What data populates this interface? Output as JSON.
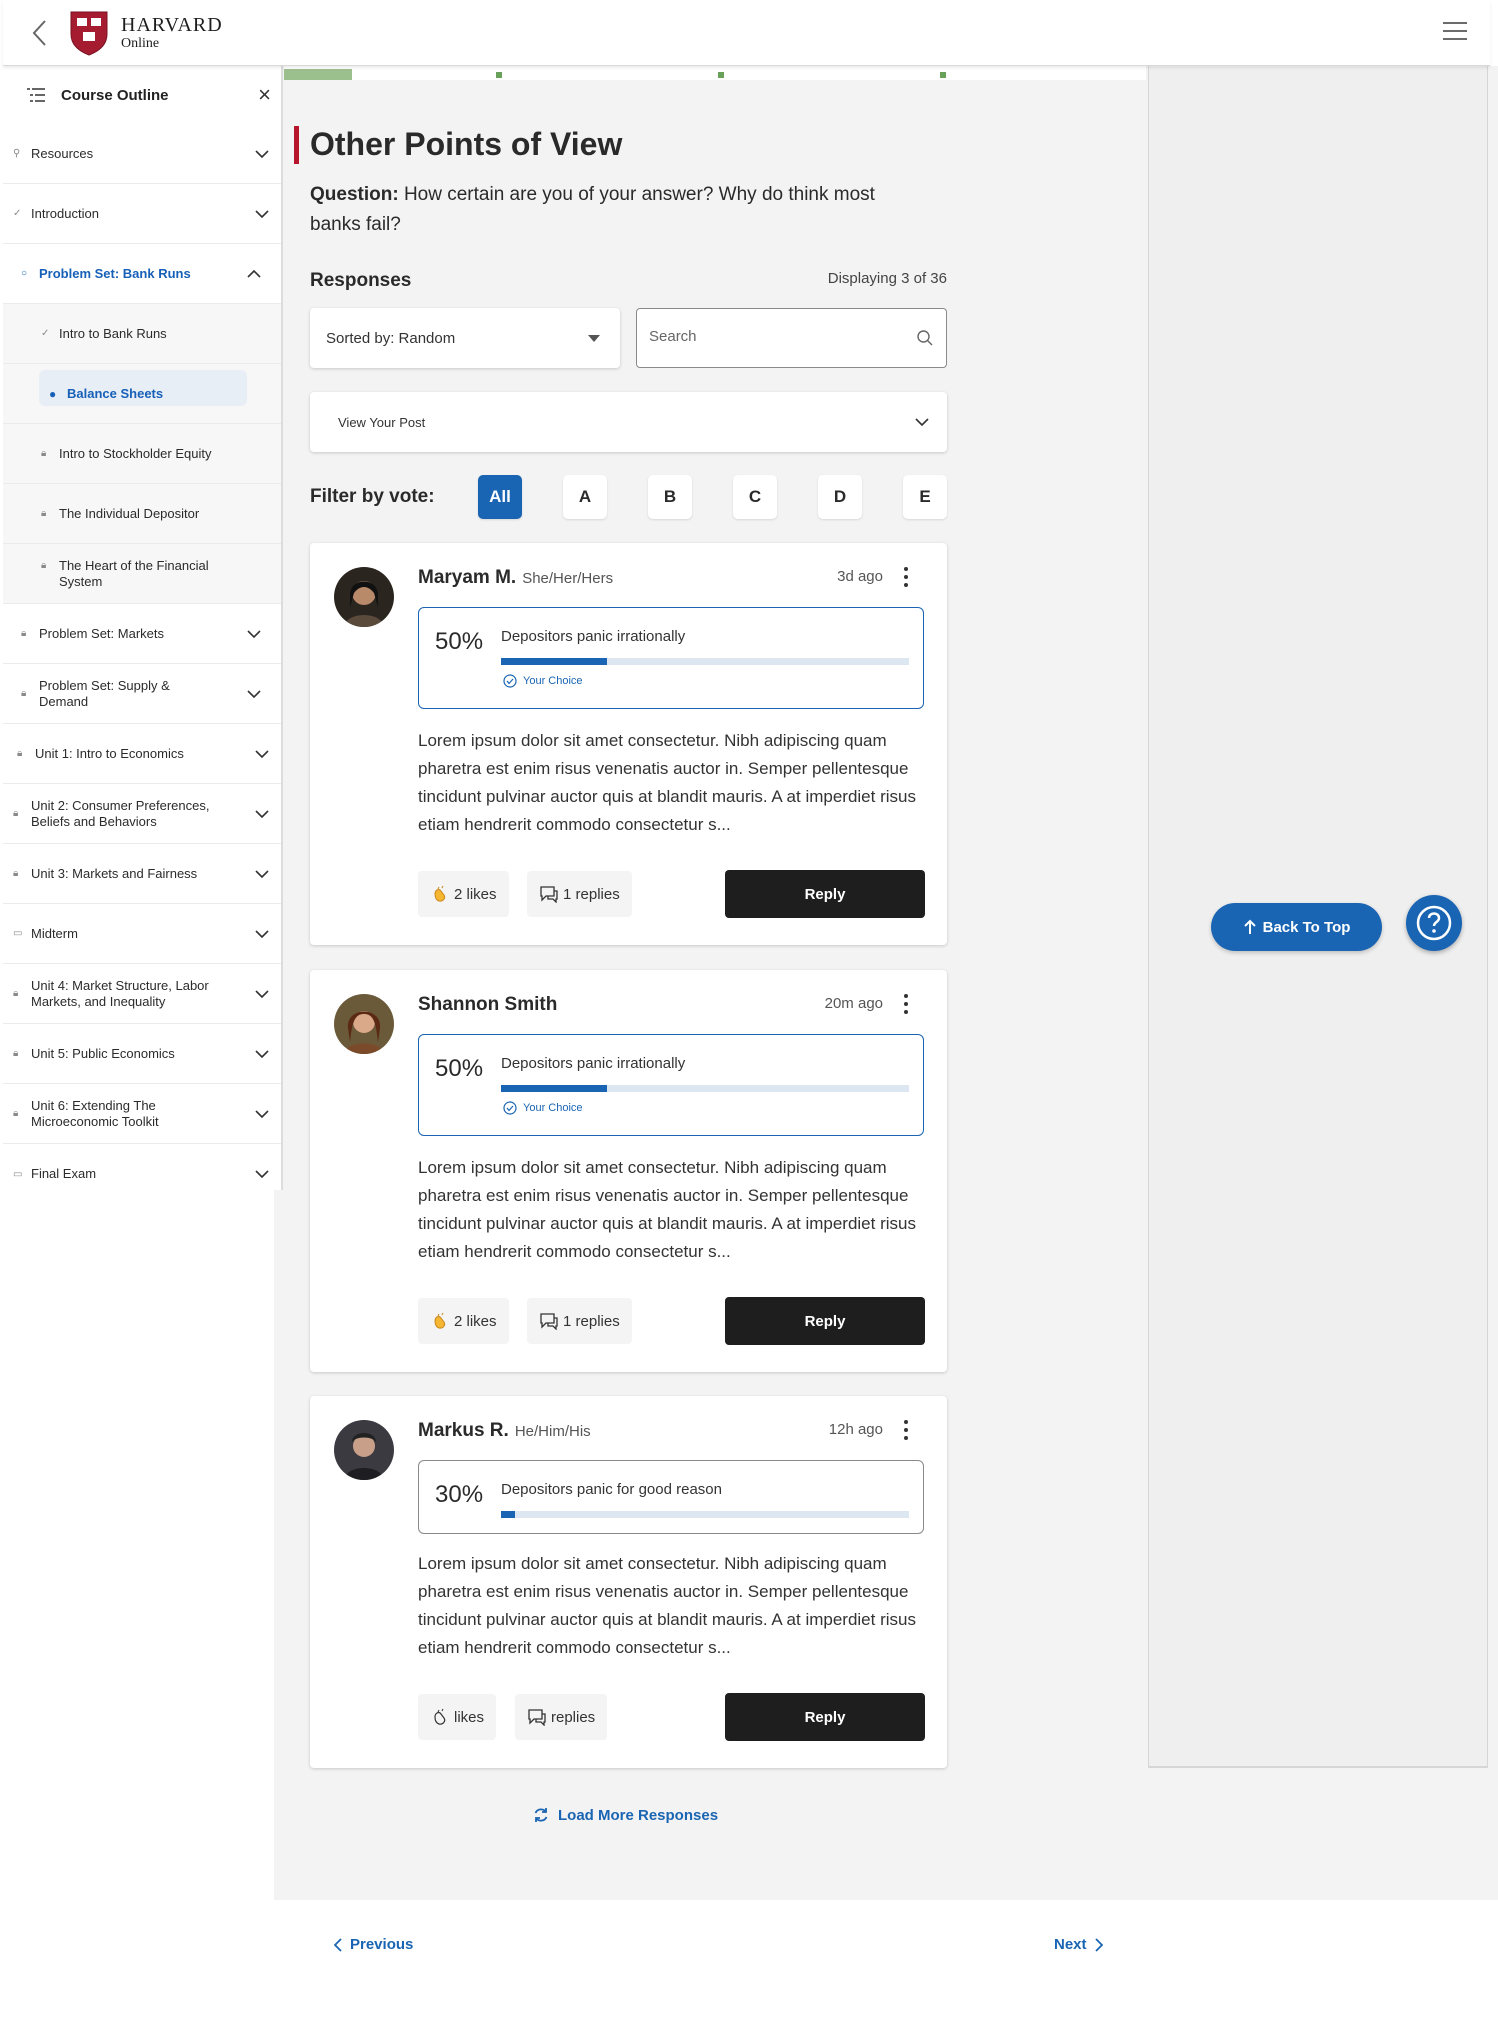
{
  "header": {
    "brand_title": "HARVARD",
    "brand_sub": "Online"
  },
  "sidebar": {
    "title": "Course Outline",
    "close": "×",
    "items": [
      {
        "label": "Resources"
      },
      {
        "label": "Introduction"
      },
      {
        "label": "Problem Set: Bank Runs"
      },
      {
        "label": "Intro to Bank Runs"
      },
      {
        "label": "Balance Sheets"
      },
      {
        "label": "Intro to Stockholder Equity"
      },
      {
        "label": "The Individual Depositor"
      },
      {
        "label": "The Heart of the Financial System"
      },
      {
        "label": "Problem Set: Markets"
      },
      {
        "label": "Problem Set: Supply & Demand"
      },
      {
        "label": "Unit 1: Intro to Economics"
      },
      {
        "label": "Unit 2: Consumer Preferences, Beliefs and Behaviors"
      },
      {
        "label": "Unit 3: Markets and Fairness"
      },
      {
        "label": "Midterm"
      },
      {
        "label": "Unit 4: Market Structure, Labor Markets, and Inequality"
      },
      {
        "label": "Unit 5: Public Economics"
      },
      {
        "label": "Unit 6: Extending The Microeconomic Toolkit"
      },
      {
        "label": "Final Exam"
      }
    ]
  },
  "main": {
    "heading": "Other Points of View",
    "question_label": "Question:",
    "question_text": "How certain are you of your answer? Why do think most banks fail?",
    "responses_title": "Responses",
    "displaying": "Displaying 3 of 36",
    "sort_label": "Sorted by: Random",
    "search_placeholder": "Search",
    "view_post": "View Your Post",
    "filter_label": "Filter by vote:",
    "filters": [
      "All",
      "A",
      "B",
      "C",
      "D",
      "E"
    ],
    "load_more": "Load More Responses",
    "previous": "Previous",
    "next": "Next"
  },
  "posts": [
    {
      "name": "Maryam M.",
      "pronouns": "She/Her/Hers",
      "ago": "3d ago",
      "pct": "50%",
      "answer": "Depositors panic irrationally",
      "fill": 0.26,
      "choice": "Your Choice",
      "body": "Lorem ipsum dolor sit amet consectetur. Nibh adipiscing quam pharetra est enim risus venenatis auctor in. Semper pellentesque tincidunt pulvinar auctor quis at blandit mauris. A at imperdiet risus etiam hendrerit commodo consectetur s...",
      "likes": "2 likes",
      "replies": "1 replies",
      "reply": "Reply"
    },
    {
      "name": "Shannon Smith",
      "pronouns": "",
      "ago": "20m ago",
      "pct": "50%",
      "answer": "Depositors panic irrationally",
      "fill": 0.26,
      "choice": "Your Choice",
      "body": "Lorem ipsum dolor sit amet consectetur. Nibh adipiscing quam pharetra est enim risus venenatis auctor in. Semper pellentesque tincidunt pulvinar auctor quis at blandit mauris. A at imperdiet risus etiam hendrerit commodo consectetur s...",
      "likes": "2 likes",
      "replies": "1 replies",
      "reply": "Reply"
    },
    {
      "name": "Markus R.",
      "pronouns": "He/Him/His",
      "ago": "12h ago",
      "pct": "30%",
      "answer": "Depositors panic for good reason",
      "fill": 0.035,
      "choice": "",
      "body": "Lorem ipsum dolor sit amet consectetur. Nibh adipiscing quam pharetra est enim risus venenatis auctor in. Semper pellentesque tincidunt pulvinar auctor quis at blandit mauris. A at imperdiet risus etiam hendrerit commodo consectetur s...",
      "likes": "likes",
      "replies": "replies",
      "reply": "Reply"
    }
  ],
  "floating": {
    "back_to_top": "Back To Top"
  },
  "colors": {
    "accent": "#1a65b3",
    "heading_bar": "#b5162b",
    "progress": "#6aa15a"
  }
}
